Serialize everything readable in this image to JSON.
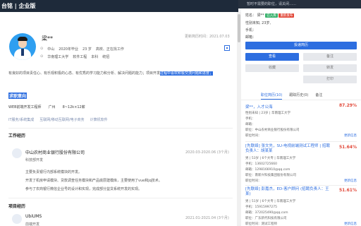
{
  "header": {
    "title": "台铭 | 企业版"
  },
  "right_header": {
    "hint": "暂时不需要的职位，请关闭……"
  },
  "candidate": {
    "name": "梁**",
    "updated": "更新简历时间：2021.07.03",
    "location": "中山",
    "work_start": "2020年毕业",
    "age": "23 岁",
    "education": "高校、正在找工作",
    "school": "华南理工大学",
    "major": "软件工程",
    "degree": "本科",
    "status": "统招"
  },
  "summary": {
    "text": "有良好的项目责任心、有乐观积极的心态、有优秀的学习能力和分析、解决问题的能力；项目开发",
    "highlight": "过程中喜欢积极交流问题和进度；"
  },
  "intent": {
    "title": "求职意向",
    "position": "WEB前端开发工程师",
    "city": "广州",
    "salary": "8~12k×12薪",
    "tags": [
      "IT服务/系统集成",
      "互联网/移动互联网/电子商务",
      "计算机软件"
    ]
  },
  "work": {
    "title": "工作经历",
    "company": "中山农村商业银行股份有限公司",
    "role": "科技部开发",
    "date": "2020.03-2020.06 (3个月)",
    "desc": [
      "主要负责银行内部系统模块的开发。",
      "开发了机房申请模块、贷款调查任务模块和产品底层建模库，主要使用了vue和jq技术。",
      "参与了农商银行微信企业号的设计和实现，完成部分益贷系统开发的实现。"
    ]
  },
  "project": {
    "title": "项目经历",
    "name": "UbiUMS",
    "role": "前端开发",
    "date": "2021.01-2021.04 (3个月)"
  },
  "right_panel": {
    "name_label": "姓名：",
    "name": "梁**",
    "badge_green": "已入库",
    "badge_red": "重新发布",
    "info": "性别未知, 23岁,",
    "phone_label": "手机：",
    "email_label": "邮箱：",
    "btn_invite": "投递简历",
    "btn_detail": "查看",
    "btn_a": "备注",
    "btn_b": "收藏",
    "btn_c": "转发",
    "btn_d": "打印",
    "tabs": [
      "职位简历(10)",
      "跟踪历史(0)",
      "备注"
    ],
    "matches": [
      {
        "title": "梁**，入才公海",
        "pct": "87.29%",
        "lines": [
          "性别未知 | 23岁 | 华南理工大学",
          "手机：",
          "邮箱：",
          "职位：中山农村商业银行股份有限公司"
        ],
        "date": "职位时间：",
        "more": "更新信息"
      },
      {
        "title": "[先联络] 张文先，SU-电视前端测试工程师 | 招聘负责人：胡某某",
        "pct": "51.64%",
        "lines": [
          "男 | 53岁 | 6个大专 | 华南理工大学",
          "手机：13602725660",
          "邮箱：1298166910@qq.com",
          "职位：南新兴科技集团股份有限公司"
        ],
        "date": "职位时间：",
        "more": "更新信息"
      },
      {
        "title": "[先联络] 彭嘉杰，ED-客户顾问 (招聘负责人：王某)",
        "pct": "51.61%",
        "lines": [
          "男 | 51岁 | 6个大专 | 华南理工大学",
          "手机：15915997275",
          "邮箱：372025490@qq.com",
          "职位：广东新代科技有限公司"
        ],
        "date": "职位时间：测试工程师",
        "more": "更新信息"
      }
    ]
  }
}
